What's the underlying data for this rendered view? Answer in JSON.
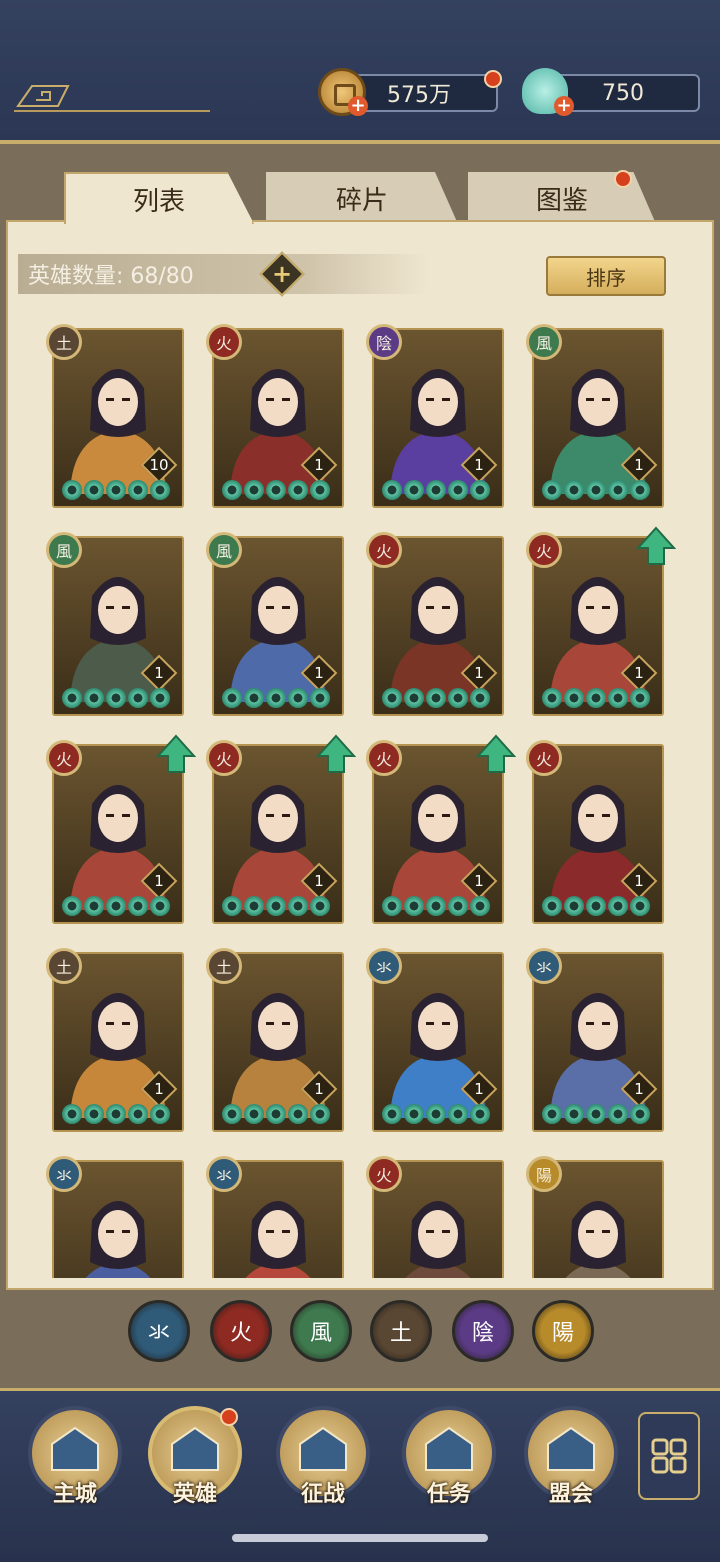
{
  "resources": {
    "coins": "575万",
    "jade": "750",
    "coin_icon": "copper-coin-icon",
    "jade_icon": "jade-shell-icon"
  },
  "tabs": [
    {
      "label": "列表",
      "active": true
    },
    {
      "label": "碎片",
      "active": false
    },
    {
      "label": "图鉴",
      "active": false,
      "badge": true
    }
  ],
  "hero_count": {
    "label": "英雄数量: 68/80"
  },
  "sort_button": "排序",
  "elements": {
    "water": {
      "glyph": "氺",
      "color": "#2f5a78"
    },
    "fire": {
      "glyph": "火",
      "color": "#8e2a22"
    },
    "wind": {
      "glyph": "風",
      "color": "#3f7a4e"
    },
    "earth": {
      "glyph": "土",
      "color": "#5a4733"
    },
    "yin": {
      "glyph": "陰",
      "color": "#5c3b86"
    },
    "yang": {
      "glyph": "陽",
      "color": "#b78a2a"
    }
  },
  "heroes": [
    {
      "element": "earth",
      "level": "10",
      "stars": 5,
      "upgrade": false,
      "tone": "#c98a3d"
    },
    {
      "element": "fire",
      "level": "1",
      "stars": 5,
      "upgrade": false,
      "tone": "#8a2f2a"
    },
    {
      "element": "yin",
      "level": "1",
      "stars": 5,
      "upgrade": false,
      "tone": "#5b3fa0"
    },
    {
      "element": "wind",
      "level": "1",
      "stars": 5,
      "upgrade": false,
      "tone": "#3d8a6b"
    },
    {
      "element": "wind",
      "level": "1",
      "stars": 5,
      "upgrade": false,
      "tone": "#4d5b4a"
    },
    {
      "element": "wind",
      "level": "1",
      "stars": 5,
      "upgrade": false,
      "tone": "#4e6aa8"
    },
    {
      "element": "fire",
      "level": "1",
      "stars": 5,
      "upgrade": false,
      "tone": "#7a3526"
    },
    {
      "element": "fire",
      "level": "1",
      "stars": 5,
      "upgrade": true,
      "tone": "#a8463a"
    },
    {
      "element": "fire",
      "level": "1",
      "stars": 5,
      "upgrade": true,
      "tone": "#a8463a"
    },
    {
      "element": "fire",
      "level": "1",
      "stars": 5,
      "upgrade": true,
      "tone": "#a8463a"
    },
    {
      "element": "fire",
      "level": "1",
      "stars": 5,
      "upgrade": true,
      "tone": "#a8463a"
    },
    {
      "element": "fire",
      "level": "1",
      "stars": 5,
      "upgrade": false,
      "tone": "#8a2a2a"
    },
    {
      "element": "earth",
      "level": "1",
      "stars": 5,
      "upgrade": false,
      "tone": "#c7873a"
    },
    {
      "element": "earth",
      "level": "1",
      "stars": 5,
      "upgrade": false,
      "tone": "#b7813e"
    },
    {
      "element": "water",
      "level": "1",
      "stars": 5,
      "upgrade": false,
      "tone": "#3f7fc8"
    },
    {
      "element": "water",
      "level": "1",
      "stars": 5,
      "upgrade": false,
      "tone": "#5a6fa8"
    },
    {
      "element": "water",
      "level": "",
      "stars": 0,
      "upgrade": false,
      "tone": "#4b5ea0"
    },
    {
      "element": "water",
      "level": "",
      "stars": 0,
      "upgrade": false,
      "tone": "#b5483a"
    },
    {
      "element": "fire",
      "level": "",
      "stars": 0,
      "upgrade": false,
      "tone": "#6e4a3a"
    },
    {
      "element": "yang",
      "level": "",
      "stars": 0,
      "upgrade": false,
      "tone": "#7a6a55"
    }
  ],
  "filters": [
    "water",
    "fire",
    "wind",
    "earth",
    "yin",
    "yang"
  ],
  "nav": [
    {
      "label": "主城",
      "icon": "palace-icon"
    },
    {
      "label": "英雄",
      "icon": "hero-icon",
      "badge": true,
      "active": true
    },
    {
      "label": "征战",
      "icon": "battle-scroll-icon"
    },
    {
      "label": "任务",
      "icon": "quest-bell-icon"
    },
    {
      "label": "盟会",
      "icon": "guild-gate-icon"
    }
  ],
  "nav_more_icon": "menu-flower-icon"
}
